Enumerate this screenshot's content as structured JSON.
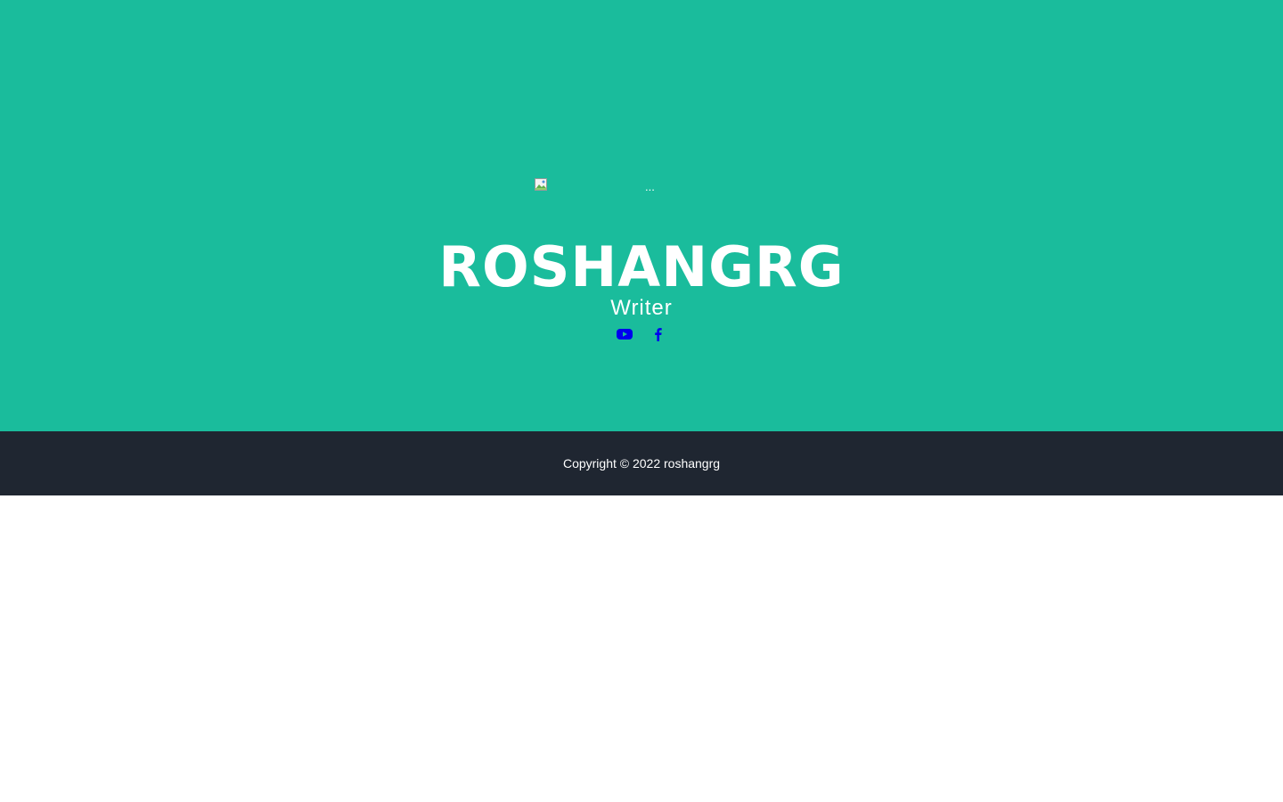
{
  "header": {
    "avatar_alt": "...",
    "title": "ROSHANGRG",
    "subtitle": "Writer"
  },
  "social": {
    "links": [
      {
        "icon": "youtube-icon",
        "color": "#0000ee"
      },
      {
        "icon": "facebook-icon",
        "color": "#0000ee"
      }
    ]
  },
  "footer": {
    "copyright": "Copyright © 2022 roshangrg"
  },
  "colors": {
    "hero_bg": "#1abc9c",
    "footer_bg": "#1f2631",
    "text": "#ffffff",
    "link": "#0000ee"
  }
}
